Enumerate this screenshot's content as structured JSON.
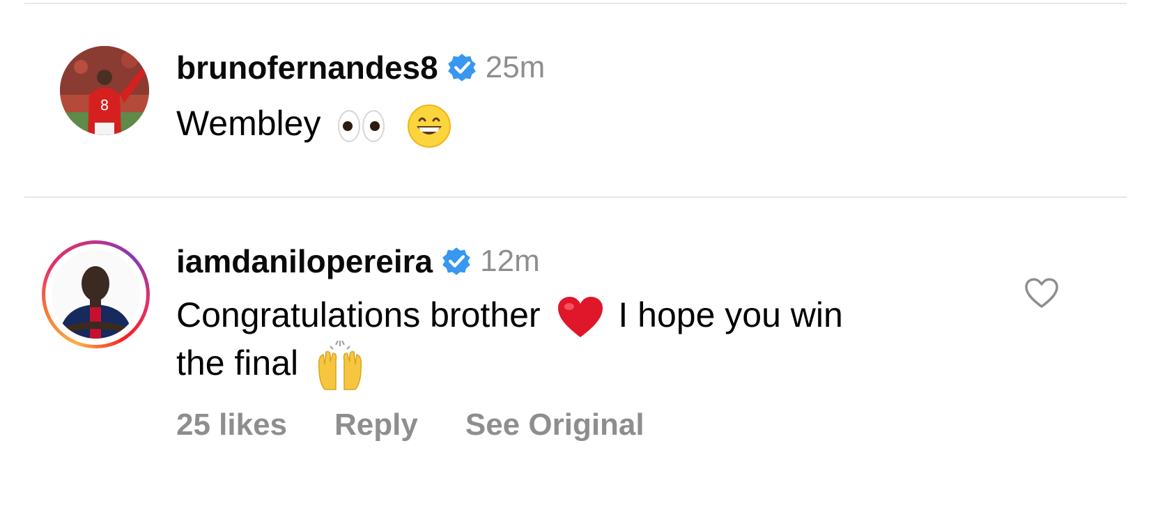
{
  "comments": [
    {
      "username": "brunofernandes8",
      "verified": true,
      "time": "25m",
      "text_before": "Wembley",
      "emojis": [
        "eyes-emoji",
        "grinning-face-emoji"
      ],
      "avatar_icon": "avatar-player-red-jersey-8"
    },
    {
      "username": "iamdanilopereira",
      "verified": true,
      "time": "12m",
      "line1_a": "Congratulations brother",
      "line1_b": "I hope you win",
      "line2": "the final",
      "emojis": [
        "red-heart-emoji",
        "raising-hands-emoji"
      ],
      "avatar_icon": "avatar-player-navy-jersey",
      "story_ring": true,
      "likes": "25 likes",
      "reply_label": "Reply",
      "see_original_label": "See Original",
      "like_icon": "heart-outline-icon"
    }
  ],
  "colors": {
    "verified_blue": "#3897f0",
    "meta_gray": "#8e8e8e",
    "divider": "#e6e6e6"
  }
}
